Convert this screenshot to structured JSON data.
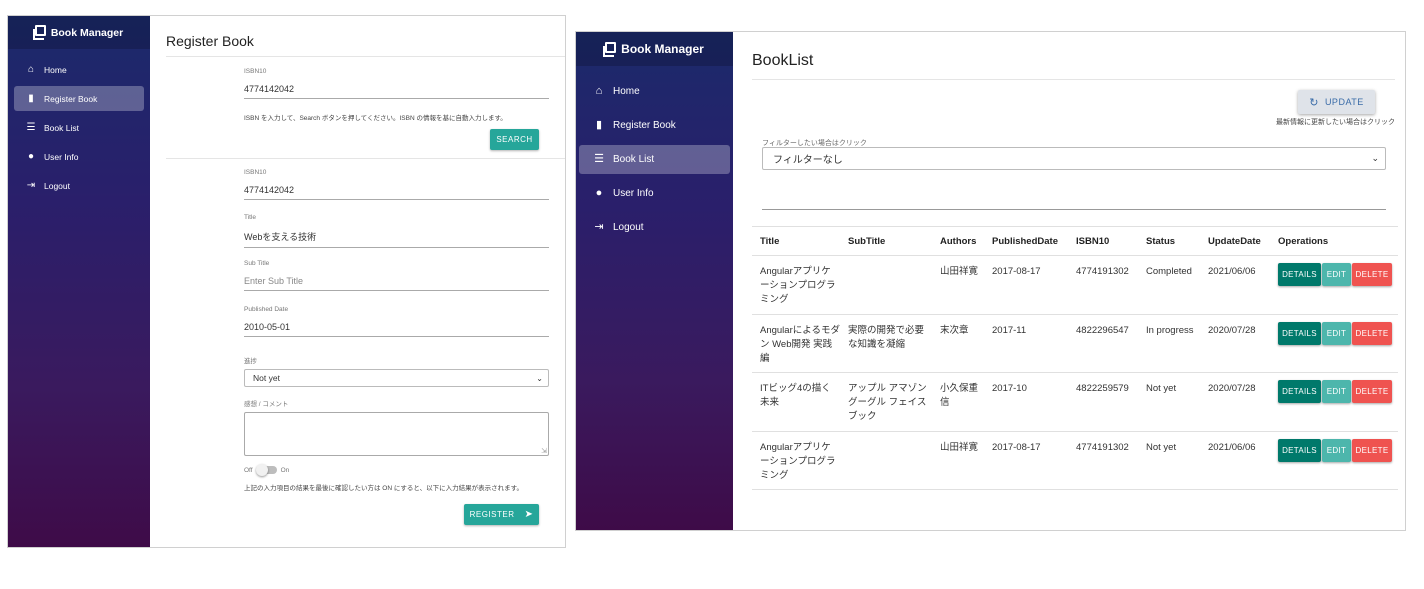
{
  "register": {
    "brand": "Book Manager",
    "nav": [
      {
        "label": "Home",
        "icon": "home-icon",
        "glyph": "⌂"
      },
      {
        "label": "Register Book",
        "icon": "book-icon",
        "glyph": "▮"
      },
      {
        "label": "Book List",
        "icon": "list-icon",
        "glyph": "☰"
      },
      {
        "label": "User Info",
        "icon": "user-icon",
        "glyph": "●"
      },
      {
        "label": "Logout",
        "icon": "logout-icon",
        "glyph": "⇥"
      }
    ],
    "active_nav": 1,
    "title": "Register Book",
    "search": {
      "isbn_label": "ISBN10",
      "isbn_value": "4774142042",
      "hint": "ISBN を入力して、Search ボタンを押してください。ISBN の情報を基に自動入力します。",
      "button": "SEARCH"
    },
    "form": {
      "isbn_label": "ISBN10",
      "isbn_value": "4774142042",
      "title_label": "Title",
      "title_value": "Webを支える技術",
      "subtitle_label": "Sub Title",
      "subtitle_placeholder": "Enter Sub Title",
      "published_label": "Published Date",
      "published_value": "2010-05-01",
      "progress_label": "進捗",
      "progress_value": "Not yet",
      "comment_label": "感想 / コメント",
      "toggle_off": "Off",
      "toggle_on": "On",
      "confirm_hint": "上記の入力項目の結果を最後に確認したい方は ON にすると、以下に入力結果が表示されます。",
      "register_button": "REGISTER"
    }
  },
  "booklist": {
    "brand": "Book Manager",
    "nav": [
      {
        "label": "Home",
        "icon": "home-icon",
        "glyph": "⌂"
      },
      {
        "label": "Register Book",
        "icon": "book-icon",
        "glyph": "▮"
      },
      {
        "label": "Book List",
        "icon": "list-icon",
        "glyph": "☰"
      },
      {
        "label": "User Info",
        "icon": "user-icon",
        "glyph": "●"
      },
      {
        "label": "Logout",
        "icon": "logout-icon",
        "glyph": "⇥"
      }
    ],
    "active_nav": 2,
    "title": "BookList",
    "update_button": "UPDATE",
    "update_hint": "最新情報に更新したい場合はクリック",
    "filter_label": "フィルターしたい場合はクリック",
    "filter_value": "フィルターなし",
    "columns": [
      "Title",
      "SubTitle",
      "Authors",
      "PublishedDate",
      "ISBN10",
      "Status",
      "UpdateDate",
      "Operations"
    ],
    "rows": [
      {
        "title": "Angularアプリケーションプログラミング",
        "subtitle": "",
        "authors": "山田祥寛",
        "published": "2017-08-17",
        "isbn": "4774191302",
        "status": "Completed",
        "updated": "2021/06/06"
      },
      {
        "title": "Angularによるモダン Web開発 実践編",
        "subtitle": "実際の開発で必要な知識を凝縮",
        "authors": "末次章",
        "published": "2017-11",
        "isbn": "4822296547",
        "status": "In progress",
        "updated": "2020/07/28"
      },
      {
        "title": "ITビッグ4の描く未来",
        "subtitle": "アップル アマゾン グーグル フェイスブック",
        "authors": "小久保重信",
        "published": "2017-10",
        "isbn": "4822259579",
        "status": "Not yet",
        "updated": "2020/07/28"
      },
      {
        "title": "Angularアプリケーションプログラミング",
        "subtitle": "",
        "authors": "山田祥寛",
        "published": "2017-08-17",
        "isbn": "4774191302",
        "status": "Not yet",
        "updated": "2021/06/06"
      }
    ],
    "ops": {
      "details": "DETAILS",
      "edit": "EDIT",
      "delete": "DELETE"
    }
  },
  "colors": {
    "teal": "#26a69a",
    "details": "#00796b",
    "edit": "#4db6ac",
    "delete": "#ef5350",
    "sidebar_top": "#1b2a6b",
    "sidebar_bottom": "#3e0b48"
  }
}
